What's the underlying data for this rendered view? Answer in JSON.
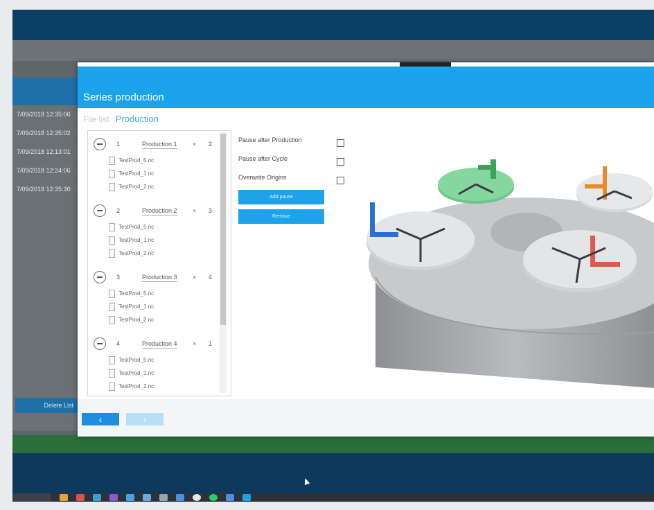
{
  "dialog": {
    "title": "Series production",
    "breadcrumb": {
      "previous": "File list",
      "current": "Production"
    },
    "productions": [
      {
        "number": "1",
        "name": "Production 1",
        "multiplier": "×",
        "count": "2",
        "files": [
          "TestProd_5.nc",
          "TestProd_1.nc",
          "TestProd_2.nc"
        ]
      },
      {
        "number": "2",
        "name": "Production 2",
        "multiplier": "×",
        "count": "3",
        "files": [
          "TestProd_5.nc",
          "TestProd_1.nc",
          "TestProd_2.nc"
        ]
      },
      {
        "number": "3",
        "name": "Production 3",
        "multiplier": "×",
        "count": "4",
        "files": [
          "TestProd_5.nc",
          "TestProd_1.nc",
          "TestProd_2.nc"
        ]
      },
      {
        "number": "4",
        "name": "Production 4",
        "multiplier": "×",
        "count": "1",
        "files": [
          "TestProd_5.nc",
          "TestProd_1.nc",
          "TestProd_2.nc"
        ]
      }
    ],
    "options": [
      {
        "label": "Pause after Production",
        "checked": false
      },
      {
        "label": "Pause after Cycle",
        "checked": false
      },
      {
        "label": "Overwrite Origins",
        "checked": false
      }
    ],
    "buttons": {
      "add": "Add pause",
      "remove": "Remove"
    },
    "nav": {
      "back": "‹",
      "next": "›"
    }
  },
  "background": {
    "timestamps": [
      "7/09/2018 12:35:06",
      "7/09/2018 12:35:02",
      "7/09/2018 12:13:01",
      "7/09/2018 12:24:06",
      "7/09/2018 12:35:30"
    ],
    "left_button": "Delete List"
  },
  "colors": {
    "accent": "#1aa3ea",
    "appbar": "#0c3f66",
    "green_fixture": "#5fbf7f",
    "orange_arm": "#e88b2a",
    "blue_arm": "#2a6fd4",
    "red_arm": "#e0584a"
  },
  "icons": [
    "minus-circle-icon",
    "file-icon",
    "chevron-left-icon",
    "chevron-right-icon",
    "mouse-cursor-icon"
  ]
}
